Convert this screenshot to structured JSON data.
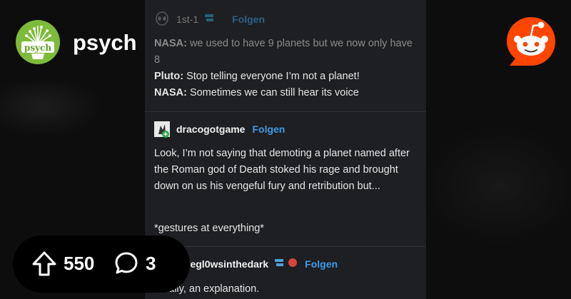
{
  "subreddit": {
    "name": "psych",
    "logo_text": "psych"
  },
  "reddit_logo": {
    "icon": "reddit-snoo-icon",
    "color": "#ff4500"
  },
  "posts": [
    {
      "username": "1st-1",
      "follow_label": "Folgen",
      "lines": [
        {
          "speaker": "NASA:",
          "text": " we used to have 9 planets but we now only have 8"
        },
        {
          "speaker": "Pluto:",
          "text": " Stop telling everyone I’m not a planet!"
        },
        {
          "speaker": "NASA:",
          "text": " Sometimes we can still hear its voice"
        }
      ]
    },
    {
      "username": "dracogotgame",
      "follow_label": "Folgen",
      "paragraphs": [
        "Look, I’m not saying that demoting a planet named after the Roman god of Death stoked his rage and brought down on us his vengeful fury and retribution but...",
        "*gestures at everything*"
      ]
    },
    {
      "username": "l0vegl0wsinthedark",
      "follow_label": "Folgen",
      "text": "Finally, an explanation."
    }
  ],
  "actions": {
    "upvotes": "550",
    "comments": "3",
    "upvote_icon": "upvote-arrow-icon",
    "comment_icon": "comment-bubble-icon"
  },
  "colors": {
    "accent_blue": "#3d9be9",
    "panel_bg": "#1e1f22",
    "sub_green": "#7dbb3a"
  }
}
